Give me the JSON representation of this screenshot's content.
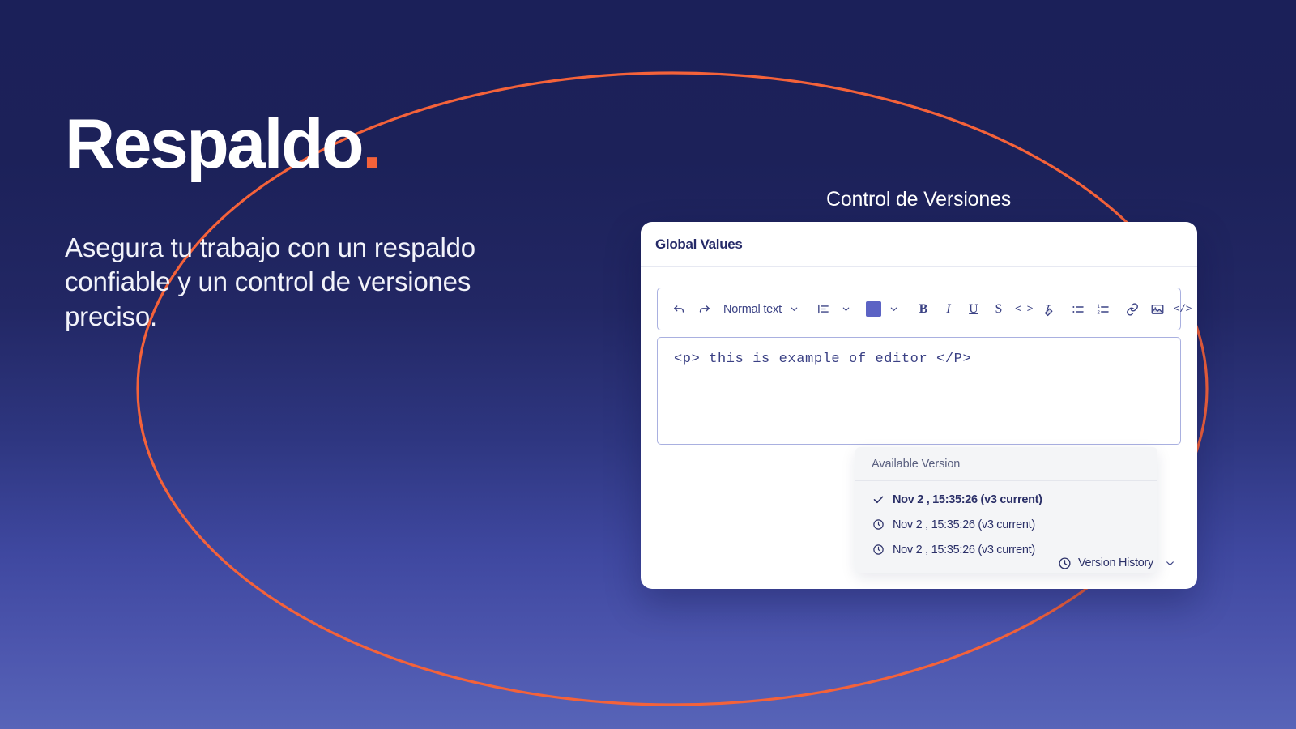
{
  "theme": {
    "bg_top": "#1b2059",
    "bg_bottom": "#5764b8",
    "accent_orange": "#f4623a",
    "navy_text": "#252a68",
    "swatch_color": "#5c63c4"
  },
  "hero": {
    "brand_name": "Respaldo",
    "brand_dot": ".",
    "subtitle": "Asegura tu trabajo con un respaldo confiable y un control de versiones preciso."
  },
  "section": {
    "caption": "Control de Versiones"
  },
  "card": {
    "title": "Global Values",
    "toolbar": {
      "undo_icon": "undo-icon",
      "redo_icon": "redo-icon",
      "style_label": "Normal text",
      "style_caret": "chevron-down-icon",
      "align_icon": "align-left-icon",
      "align_caret": "chevron-down-icon",
      "color_swatch": "color-swatch",
      "color_caret": "chevron-down-icon",
      "bold_label": "B",
      "italic_label": "I",
      "underline_label": "U",
      "strike_label": "S",
      "inline_code_label": "< >",
      "clear_format_icon": "clear-formatting-icon",
      "bullet_list_icon": "bullet-list-icon",
      "numbered_list_icon": "numbered-list-icon",
      "link_icon": "link-icon",
      "image_icon": "image-icon",
      "code_block_label": "</>",
      "quote_label": "““",
      "divider_label": "—"
    },
    "editor": {
      "content": "<p> this is example of editor </P>"
    },
    "dropdown": {
      "header": "Available Version",
      "items": [
        {
          "icon": "check-icon",
          "label": "Nov 2 , 15:35:26 (v3 current)",
          "current": true
        },
        {
          "icon": "clock-icon",
          "label": "Nov 2 , 15:35:26 (v3 current)",
          "current": false
        },
        {
          "icon": "clock-icon",
          "label": "Nov 2 , 15:35:26 (v3 current)",
          "current": false
        }
      ]
    },
    "footer": {
      "clock_icon": "clock-icon",
      "version_history_label": "Version History",
      "caret_icon": "chevron-down-icon"
    }
  }
}
